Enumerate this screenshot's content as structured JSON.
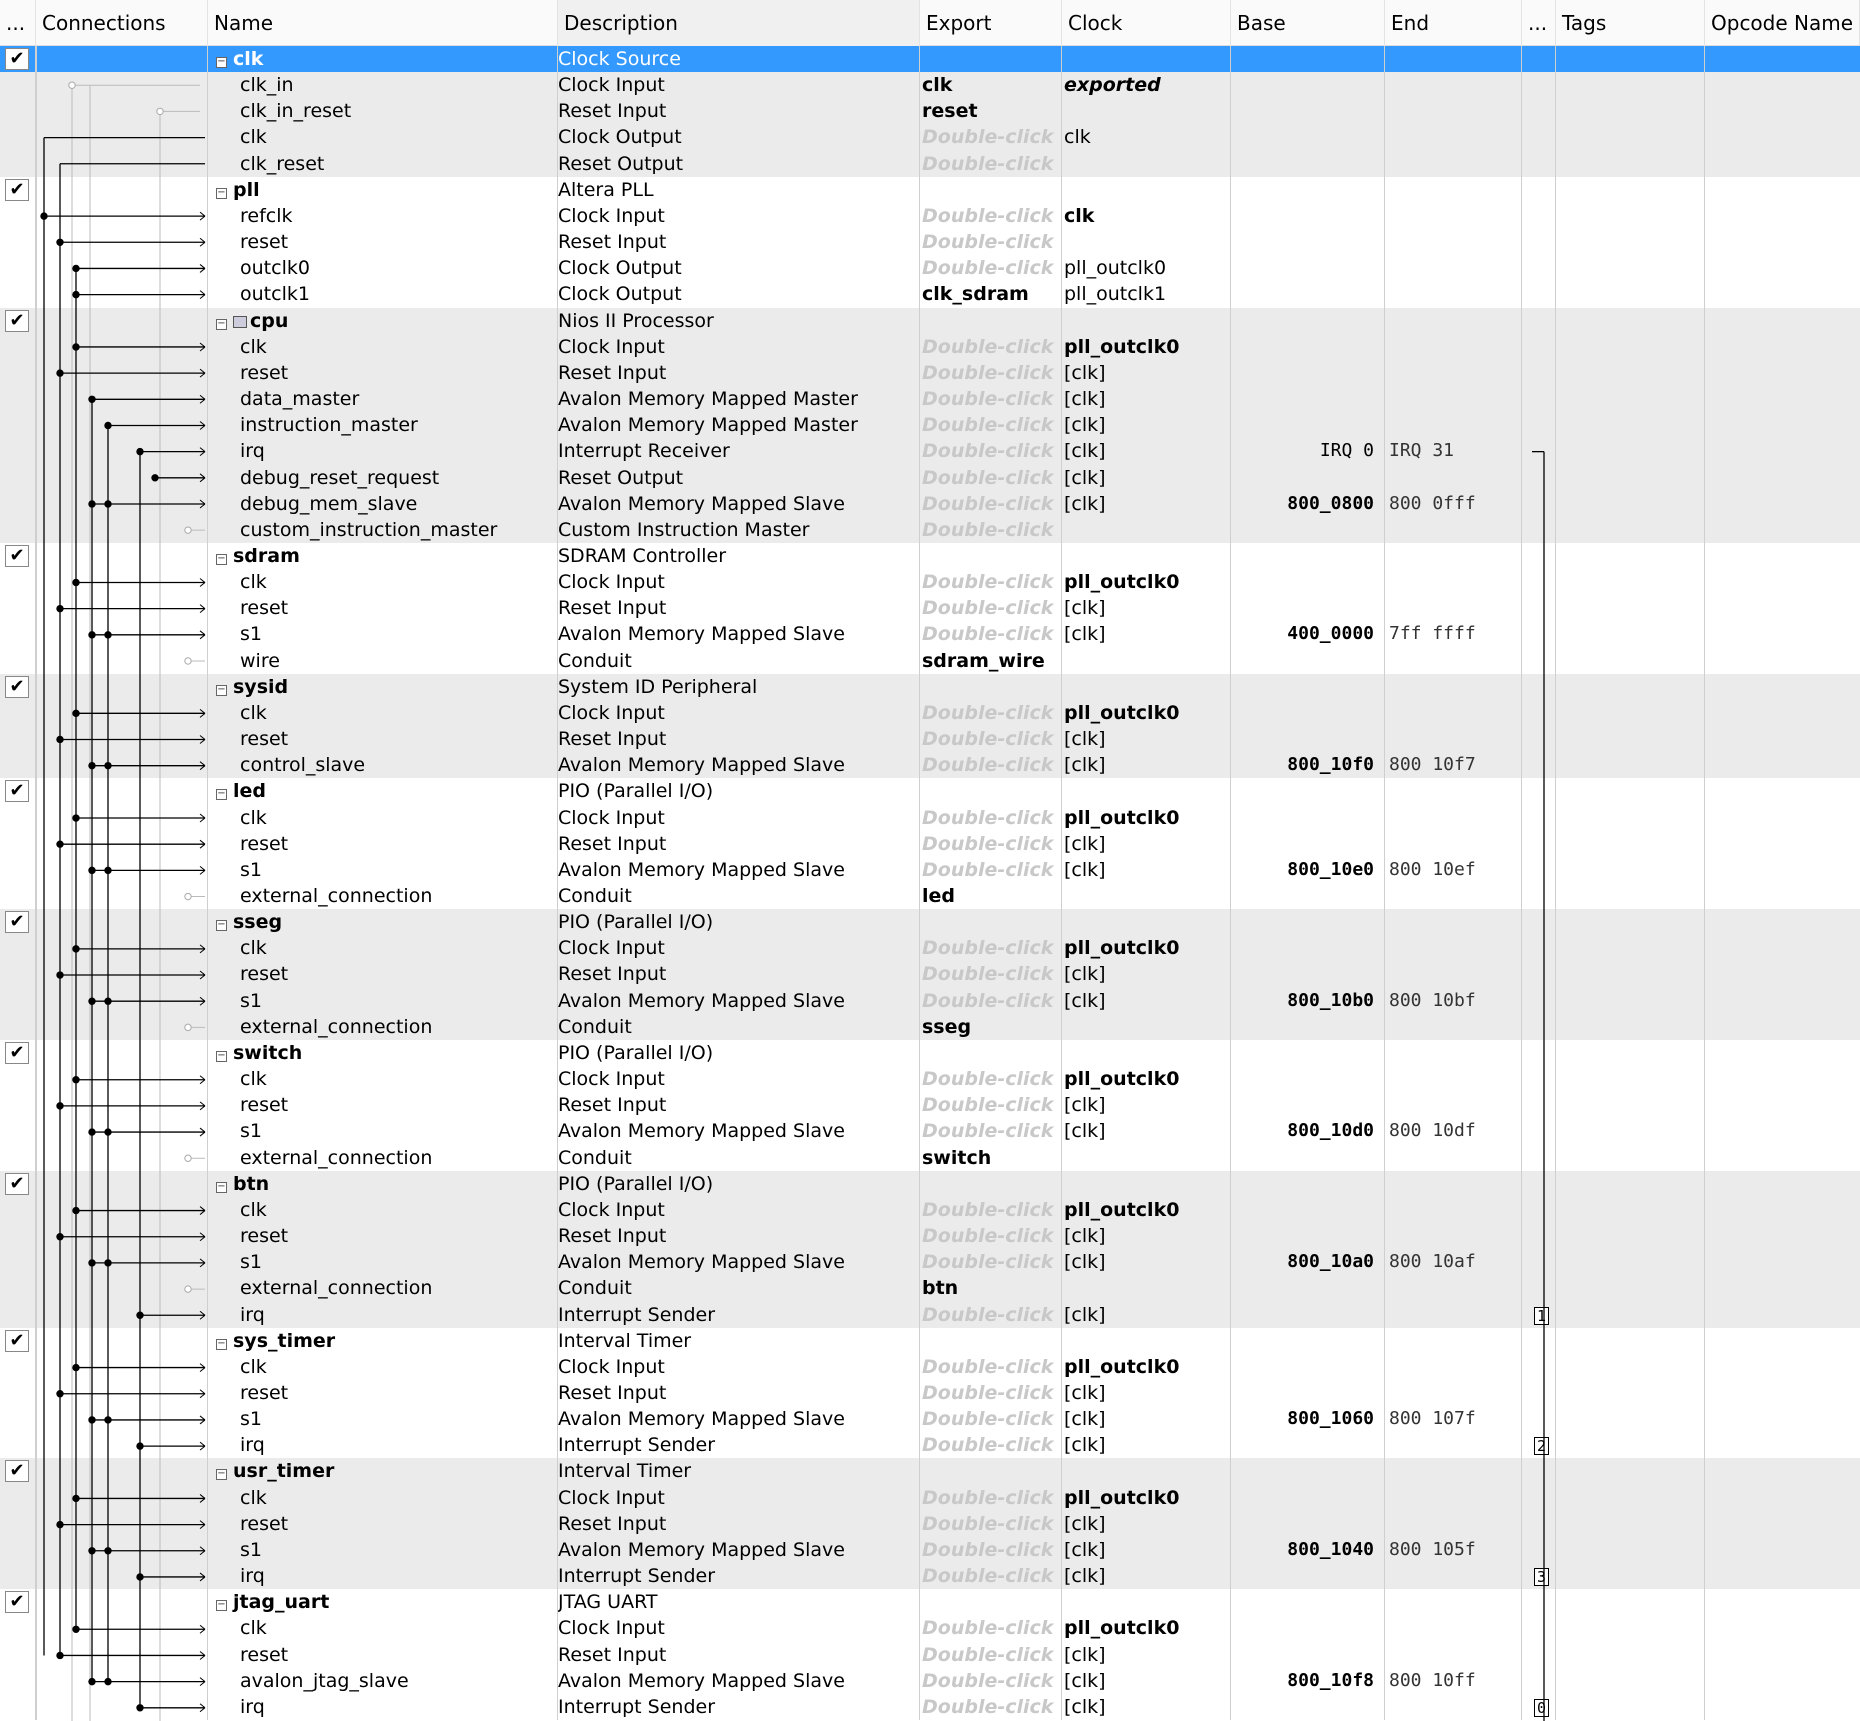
{
  "header": [
    "...",
    "Connections",
    "Name",
    "Description",
    "Export",
    "Clock",
    "Base",
    "End",
    "...",
    "Tags",
    "Opcode Name"
  ],
  "checkmark": "✔",
  "placeholder": "Double-click",
  "rows": [
    {
      "t": "grp",
      "name": "clk",
      "desc": "Clock Source",
      "selected": true
    },
    {
      "name": "clk_in",
      "desc": "Clock Input",
      "export": "clk",
      "clock": "exported",
      "cs": "bi"
    },
    {
      "name": "clk_in_reset",
      "desc": "Reset Input",
      "export": "reset"
    },
    {
      "name": "clk",
      "desc": "Clock Output",
      "export": null,
      "clock": "clk",
      "cs": ""
    },
    {
      "name": "clk_reset",
      "desc": "Reset Output",
      "export": null
    },
    {
      "t": "grp",
      "name": "pll",
      "desc": "Altera PLL"
    },
    {
      "name": "refclk",
      "desc": "Clock Input",
      "export": null,
      "clock": "clk",
      "cs": "b"
    },
    {
      "name": "reset",
      "desc": "Reset Input",
      "export": null
    },
    {
      "name": "outclk0",
      "desc": "Clock Output",
      "export": null,
      "clock": "pll_outclk0",
      "cs": ""
    },
    {
      "name": "outclk1",
      "desc": "Clock Output",
      "export": "clk_sdram",
      "clock": "pll_outclk1",
      "cs": ""
    },
    {
      "t": "grp",
      "name": "cpu",
      "desc": "Nios II Processor",
      "icon": "processor-icon"
    },
    {
      "name": "clk",
      "desc": "Clock Input",
      "export": null,
      "clock": "pll_outclk0",
      "cs": "b"
    },
    {
      "name": "reset",
      "desc": "Reset Input",
      "export": null,
      "clock": "[clk]",
      "cs": ""
    },
    {
      "name": "data_master",
      "desc": "Avalon Memory Mapped Master",
      "export": null,
      "clock": "[clk]",
      "cs": ""
    },
    {
      "name": "instruction_master",
      "desc": "Avalon Memory Mapped Master",
      "export": null,
      "clock": "[clk]",
      "cs": ""
    },
    {
      "name": "irq",
      "desc": "Interrupt Receiver",
      "export": null,
      "clock": "[clk]",
      "cs": "",
      "base": "IRQ 0",
      "end": "IRQ 31",
      "irqrecv": true
    },
    {
      "name": "debug_reset_request",
      "desc": "Reset Output",
      "export": null,
      "clock": "[clk]",
      "cs": ""
    },
    {
      "name": "debug_mem_slave",
      "desc": "Avalon Memory Mapped Slave",
      "export": null,
      "clock": "[clk]",
      "cs": "",
      "base": "800_0800",
      "end": "800 0fff"
    },
    {
      "name": "custom_instruction_master",
      "desc": "Custom Instruction Master",
      "export": null
    },
    {
      "t": "grp",
      "name": "sdram",
      "desc": "SDRAM Controller"
    },
    {
      "name": "clk",
      "desc": "Clock Input",
      "export": null,
      "clock": "pll_outclk0",
      "cs": "b"
    },
    {
      "name": "reset",
      "desc": "Reset Input",
      "export": null,
      "clock": "[clk]",
      "cs": ""
    },
    {
      "name": "s1",
      "desc": "Avalon Memory Mapped Slave",
      "export": null,
      "clock": "[clk]",
      "cs": "",
      "base": "400_0000",
      "end": "7ff ffff"
    },
    {
      "name": "wire",
      "desc": "Conduit",
      "export": "sdram_wire"
    },
    {
      "t": "grp",
      "name": "sysid",
      "desc": "System ID Peripheral"
    },
    {
      "name": "clk",
      "desc": "Clock Input",
      "export": null,
      "clock": "pll_outclk0",
      "cs": "b"
    },
    {
      "name": "reset",
      "desc": "Reset Input",
      "export": null,
      "clock": "[clk]",
      "cs": ""
    },
    {
      "name": "control_slave",
      "desc": "Avalon Memory Mapped Slave",
      "export": null,
      "clock": "[clk]",
      "cs": "",
      "base": "800_10f0",
      "end": "800 10f7"
    },
    {
      "t": "grp",
      "name": "led",
      "desc": "PIO (Parallel I/O)"
    },
    {
      "name": "clk",
      "desc": "Clock Input",
      "export": null,
      "clock": "pll_outclk0",
      "cs": "b"
    },
    {
      "name": "reset",
      "desc": "Reset Input",
      "export": null,
      "clock": "[clk]",
      "cs": ""
    },
    {
      "name": "s1",
      "desc": "Avalon Memory Mapped Slave",
      "export": null,
      "clock": "[clk]",
      "cs": "",
      "base": "800_10e0",
      "end": "800 10ef"
    },
    {
      "name": "external_connection",
      "desc": "Conduit",
      "export": "led"
    },
    {
      "t": "grp",
      "name": "sseg",
      "desc": "PIO (Parallel I/O)"
    },
    {
      "name": "clk",
      "desc": "Clock Input",
      "export": null,
      "clock": "pll_outclk0",
      "cs": "b"
    },
    {
      "name": "reset",
      "desc": "Reset Input",
      "export": null,
      "clock": "[clk]",
      "cs": ""
    },
    {
      "name": "s1",
      "desc": "Avalon Memory Mapped Slave",
      "export": null,
      "clock": "[clk]",
      "cs": "",
      "base": "800_10b0",
      "end": "800 10bf"
    },
    {
      "name": "external_connection",
      "desc": "Conduit",
      "export": "sseg"
    },
    {
      "t": "grp",
      "name": "switch",
      "desc": "PIO (Parallel I/O)"
    },
    {
      "name": "clk",
      "desc": "Clock Input",
      "export": null,
      "clock": "pll_outclk0",
      "cs": "b"
    },
    {
      "name": "reset",
      "desc": "Reset Input",
      "export": null,
      "clock": "[clk]",
      "cs": ""
    },
    {
      "name": "s1",
      "desc": "Avalon Memory Mapped Slave",
      "export": null,
      "clock": "[clk]",
      "cs": "",
      "base": "800_10d0",
      "end": "800 10df"
    },
    {
      "name": "external_connection",
      "desc": "Conduit",
      "export": "switch"
    },
    {
      "t": "grp",
      "name": "btn",
      "desc": "PIO (Parallel I/O)"
    },
    {
      "name": "clk",
      "desc": "Clock Input",
      "export": null,
      "clock": "pll_outclk0",
      "cs": "b"
    },
    {
      "name": "reset",
      "desc": "Reset Input",
      "export": null,
      "clock": "[clk]",
      "cs": ""
    },
    {
      "name": "s1",
      "desc": "Avalon Memory Mapped Slave",
      "export": null,
      "clock": "[clk]",
      "cs": "",
      "base": "800_10a0",
      "end": "800 10af"
    },
    {
      "name": "external_connection",
      "desc": "Conduit",
      "export": "btn"
    },
    {
      "name": "irq",
      "desc": "Interrupt Sender",
      "export": null,
      "clock": "[clk]",
      "cs": "",
      "irq": "1"
    },
    {
      "t": "grp",
      "name": "sys_timer",
      "desc": "Interval Timer"
    },
    {
      "name": "clk",
      "desc": "Clock Input",
      "export": null,
      "clock": "pll_outclk0",
      "cs": "b"
    },
    {
      "name": "reset",
      "desc": "Reset Input",
      "export": null,
      "clock": "[clk]",
      "cs": ""
    },
    {
      "name": "s1",
      "desc": "Avalon Memory Mapped Slave",
      "export": null,
      "clock": "[clk]",
      "cs": "",
      "base": "800_1060",
      "end": "800 107f"
    },
    {
      "name": "irq",
      "desc": "Interrupt Sender",
      "export": null,
      "clock": "[clk]",
      "cs": "",
      "irq": "2"
    },
    {
      "t": "grp",
      "name": "usr_timer",
      "desc": "Interval Timer"
    },
    {
      "name": "clk",
      "desc": "Clock Input",
      "export": null,
      "clock": "pll_outclk0",
      "cs": "b"
    },
    {
      "name": "reset",
      "desc": "Reset Input",
      "export": null,
      "clock": "[clk]",
      "cs": ""
    },
    {
      "name": "s1",
      "desc": "Avalon Memory Mapped Slave",
      "export": null,
      "clock": "[clk]",
      "cs": "",
      "base": "800_1040",
      "end": "800 105f"
    },
    {
      "name": "irq",
      "desc": "Interrupt Sender",
      "export": null,
      "clock": "[clk]",
      "cs": "",
      "irq": "3"
    },
    {
      "t": "grp",
      "name": "jtag_uart",
      "desc": "JTAG UART"
    },
    {
      "name": "clk",
      "desc": "Clock Input",
      "export": null,
      "clock": "pll_outclk0",
      "cs": "b"
    },
    {
      "name": "reset",
      "desc": "Reset Input",
      "export": null,
      "clock": "[clk]",
      "cs": ""
    },
    {
      "name": "avalon_jtag_slave",
      "desc": "Avalon Memory Mapped Slave",
      "export": null,
      "clock": "[clk]",
      "cs": "",
      "base": "800_10f8",
      "end": "800 10ff"
    },
    {
      "name": "irq",
      "desc": "Interrupt Sender",
      "export": null,
      "clock": "[clk]",
      "cs": "",
      "irq": "0"
    }
  ],
  "colors": {
    "selected": "#3399ff",
    "group_gray": "#ebebeb",
    "placeholder": "#c8c8c8"
  }
}
